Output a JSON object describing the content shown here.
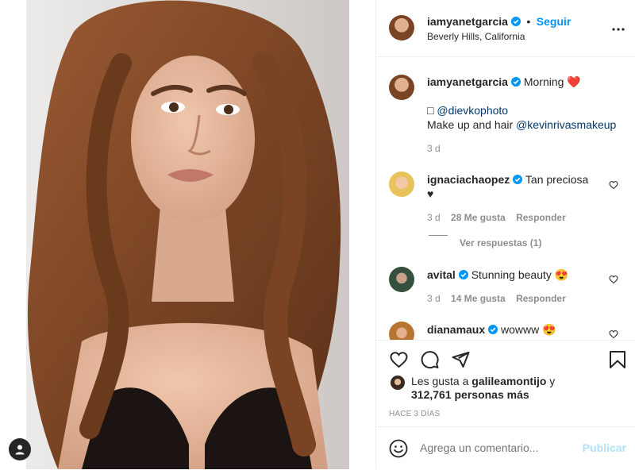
{
  "post": {
    "author": "iamyanetgarcia",
    "follow_label": "Seguir",
    "separator": "•",
    "location": "Beverly Hills, California",
    "photo_alt": "Retrato de mujer con cabello castaño ondulado"
  },
  "caption": {
    "author": "iamyanetgarcia",
    "text": "Morning",
    "emoji": "❤️",
    "line2_prefix": "□",
    "credit_photo": "@dievkophoto",
    "line3_text": "Make up and hair",
    "credit_makeup": "@kevinrivasmakeup",
    "time": "3 d"
  },
  "comments": [
    {
      "author": "ignaciachaopez",
      "text": "Tan preciosa",
      "text2": "♥",
      "time": "3 d",
      "likes": "28 Me gusta",
      "reply": "Responder",
      "view_replies": "Ver respuestas (1)"
    },
    {
      "author": "avital",
      "text": "Stunning beauty",
      "emoji": "😍",
      "time": "3 d",
      "likes": "14 Me gusta",
      "reply": "Responder"
    },
    {
      "author": "dianamaux",
      "text": "wowww",
      "emoji": "😍"
    }
  ],
  "likes": {
    "prefix": "Les gusta a",
    "user": "galileamontijo",
    "connector": "y",
    "count": "312,761 personas más"
  },
  "posted_ago": "HACE 3 DÍAS",
  "add_comment": {
    "placeholder": "Agrega un comentario...",
    "publish_label": "Publicar"
  },
  "icons": {
    "like": "heart-icon",
    "comment": "comment-icon",
    "share": "share-icon",
    "save": "bookmark-icon",
    "emoji": "emoji-icon",
    "more": "more-options-icon",
    "user_tag": "user-icon"
  },
  "colors": {
    "accent": "#0095f6",
    "link": "#00376b",
    "muted": "#8e8e8e",
    "publish_disabled": "#b2dffc",
    "border": "#efefef"
  }
}
